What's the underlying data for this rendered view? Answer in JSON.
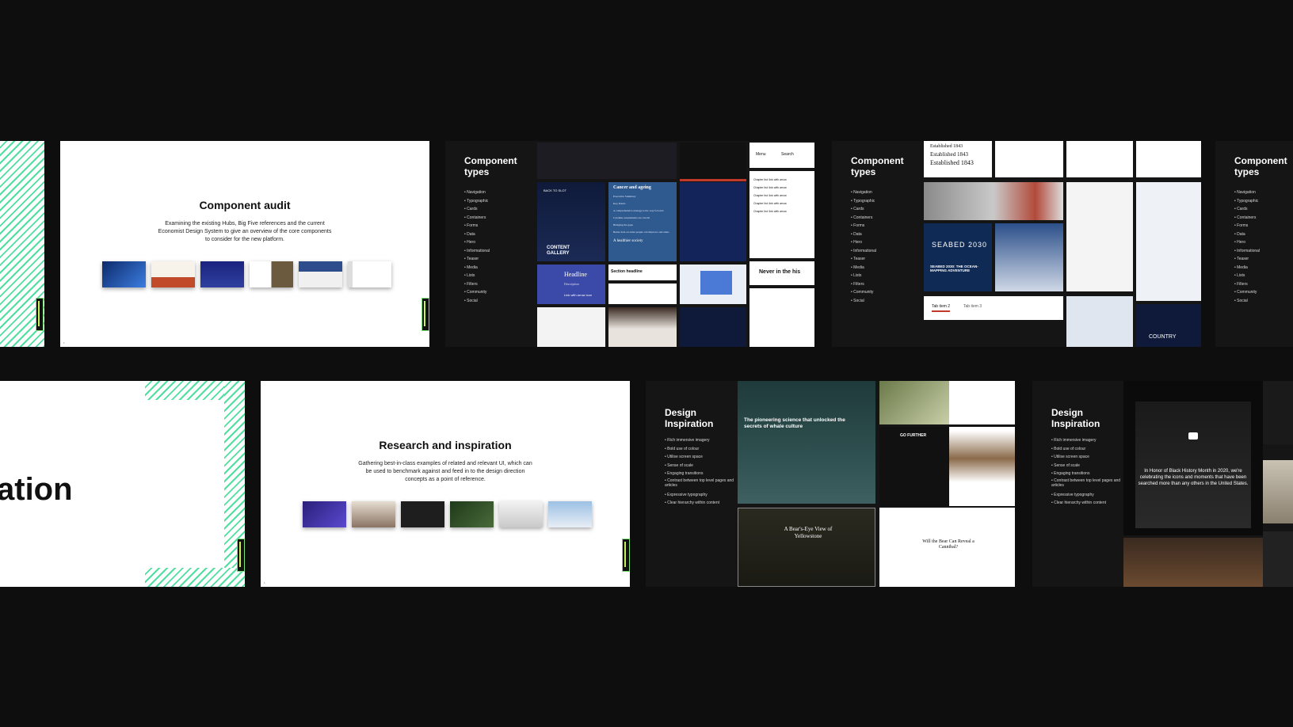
{
  "slides": {
    "component_audit": {
      "title": "Component audit",
      "description": "Examining the existing Hubs, Big Five references and the current Economist Design System to give an overview of the core components to consider for the new platform.",
      "thumb_colors": [
        "#1b3a8a",
        "#f2eee6",
        "#1a237e",
        "#e8e4dc",
        "#2d4d8c",
        "#ffffff"
      ]
    },
    "component_types": {
      "title": "Component types",
      "items": [
        "Navigation",
        "Typographic",
        "Cards",
        "Containers",
        "Forms",
        "Data",
        "Hero",
        "Informational",
        "Teaser",
        "Media",
        "Lists",
        "Filters",
        "Community",
        "Social"
      ],
      "collage": {
        "cancer_title": "Cancer and ageing",
        "cancer_items": [
          "Executive Summary",
          "Key Points",
          "A comprehensive strategy is the way forward",
          "Cytokine assessments are crucial",
          "Bridging the gaps",
          "Better data on older people can improve outcomes"
        ],
        "healthier": "A healthier society",
        "headline": "Headline",
        "headline_sub": "Description",
        "link_arrow": "Link with arrow icon",
        "section_headline": "Section headline",
        "section_subheadline": "Section subheadline",
        "menu": "Menu",
        "search": "Search",
        "chapter_link": "Chapter list: link with arrow",
        "never": "Never in the his",
        "back_to_slot": "BACK TO SLOT",
        "content_gallery": "CONTENT GALLERY",
        "established": "Established 1843",
        "seabed": "SEABED 2030",
        "seabed_caption": "SEABED 2030: THE OCEAN-MAPPING ADVENTURE",
        "tab2": "Tab item 2",
        "tab3": "Tab item 3",
        "country": "COUNTRY"
      }
    },
    "partial_title": "ation",
    "research": {
      "title": "Research and inspiration",
      "description": "Gathering best-in-class examples of related and relevant UI, which can be used to benchmark against and feed in to the design direction concepts as a point of reference.",
      "thumb_colors": [
        "#3a2fa0",
        "#d8cfc4",
        "#2a2a2a",
        "#2f4a2a",
        "#e6e6e6",
        "#b9cfe4"
      ]
    },
    "design_inspiration": {
      "title": "Design Inspiration",
      "items": [
        "Rich immersive imagery",
        "Bold use of colour",
        "Utilise screen space",
        "Sense of scale",
        "Engaging transitions",
        "Contrast between top level pages and articles",
        "Expressive typography",
        "Clear hierarchy within content"
      ],
      "whale_heading": "The pioneering science that unlocked the secrets of whale culture",
      "bear_heading": "A Bear's-Eye View of Yellowstone",
      "go_further": "GO FURTHER",
      "cannibal": "Will the Bear Can Reveal a Cannibal?",
      "bhm_text": "In Honor of Black History Month in 2020, we're celebrating the icons and moments that have been searched more than any others in the United States."
    }
  }
}
